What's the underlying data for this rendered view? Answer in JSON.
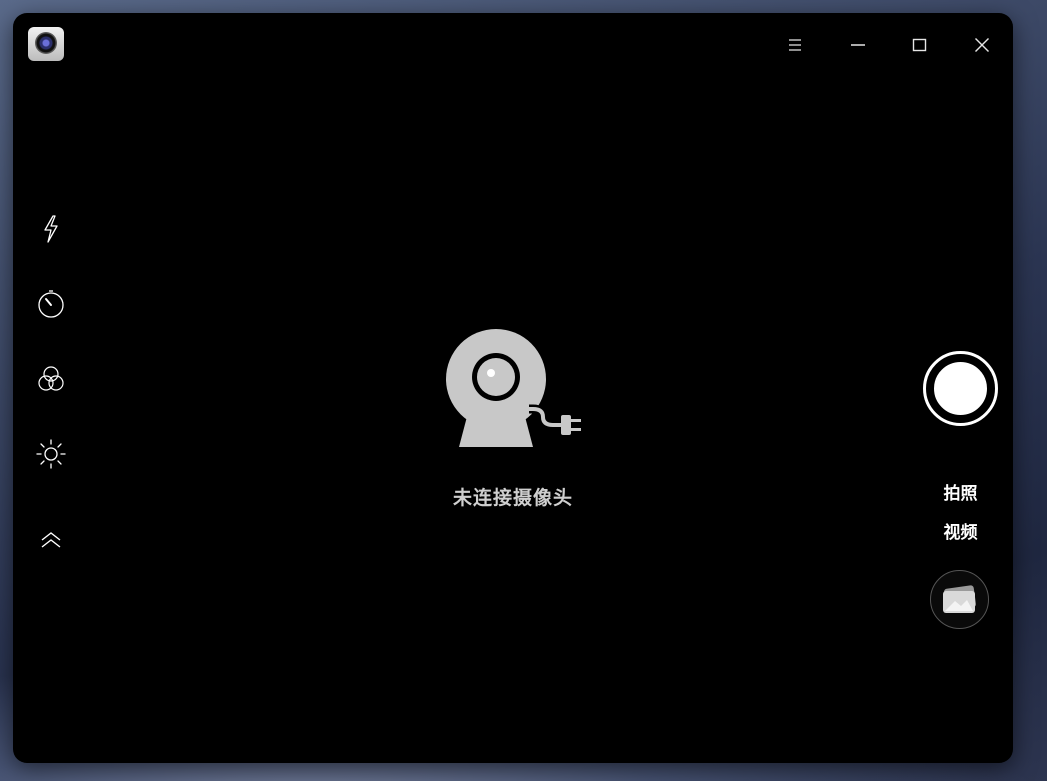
{
  "window": {
    "app_icon": "camera-app-icon",
    "titlebar": {
      "menu_icon": "menu-icon",
      "minimize_icon": "minimize-icon",
      "maximize_icon": "maximize-icon",
      "close_icon": "close-icon"
    }
  },
  "left_toolbar": {
    "items": [
      {
        "name": "flash",
        "icon": "flash-icon"
      },
      {
        "name": "timer",
        "icon": "timer-icon"
      },
      {
        "name": "filter",
        "icon": "color-filter-icon"
      },
      {
        "name": "exposure",
        "icon": "brightness-icon"
      },
      {
        "name": "collapse",
        "icon": "double-chevron-up-icon"
      }
    ]
  },
  "main": {
    "no_camera_icon": "webcam-unplugged-icon",
    "no_camera_text": "未连接摄像头"
  },
  "right_panel": {
    "shutter_icon": "shutter-button",
    "modes": [
      "拍照",
      "视频"
    ],
    "gallery_icon": "gallery-icon"
  },
  "colors": {
    "window_bg": "#000000",
    "text_primary": "#ffffff",
    "text_muted": "#cfcfcf",
    "placeholder_icon": "#c8c8c8"
  }
}
